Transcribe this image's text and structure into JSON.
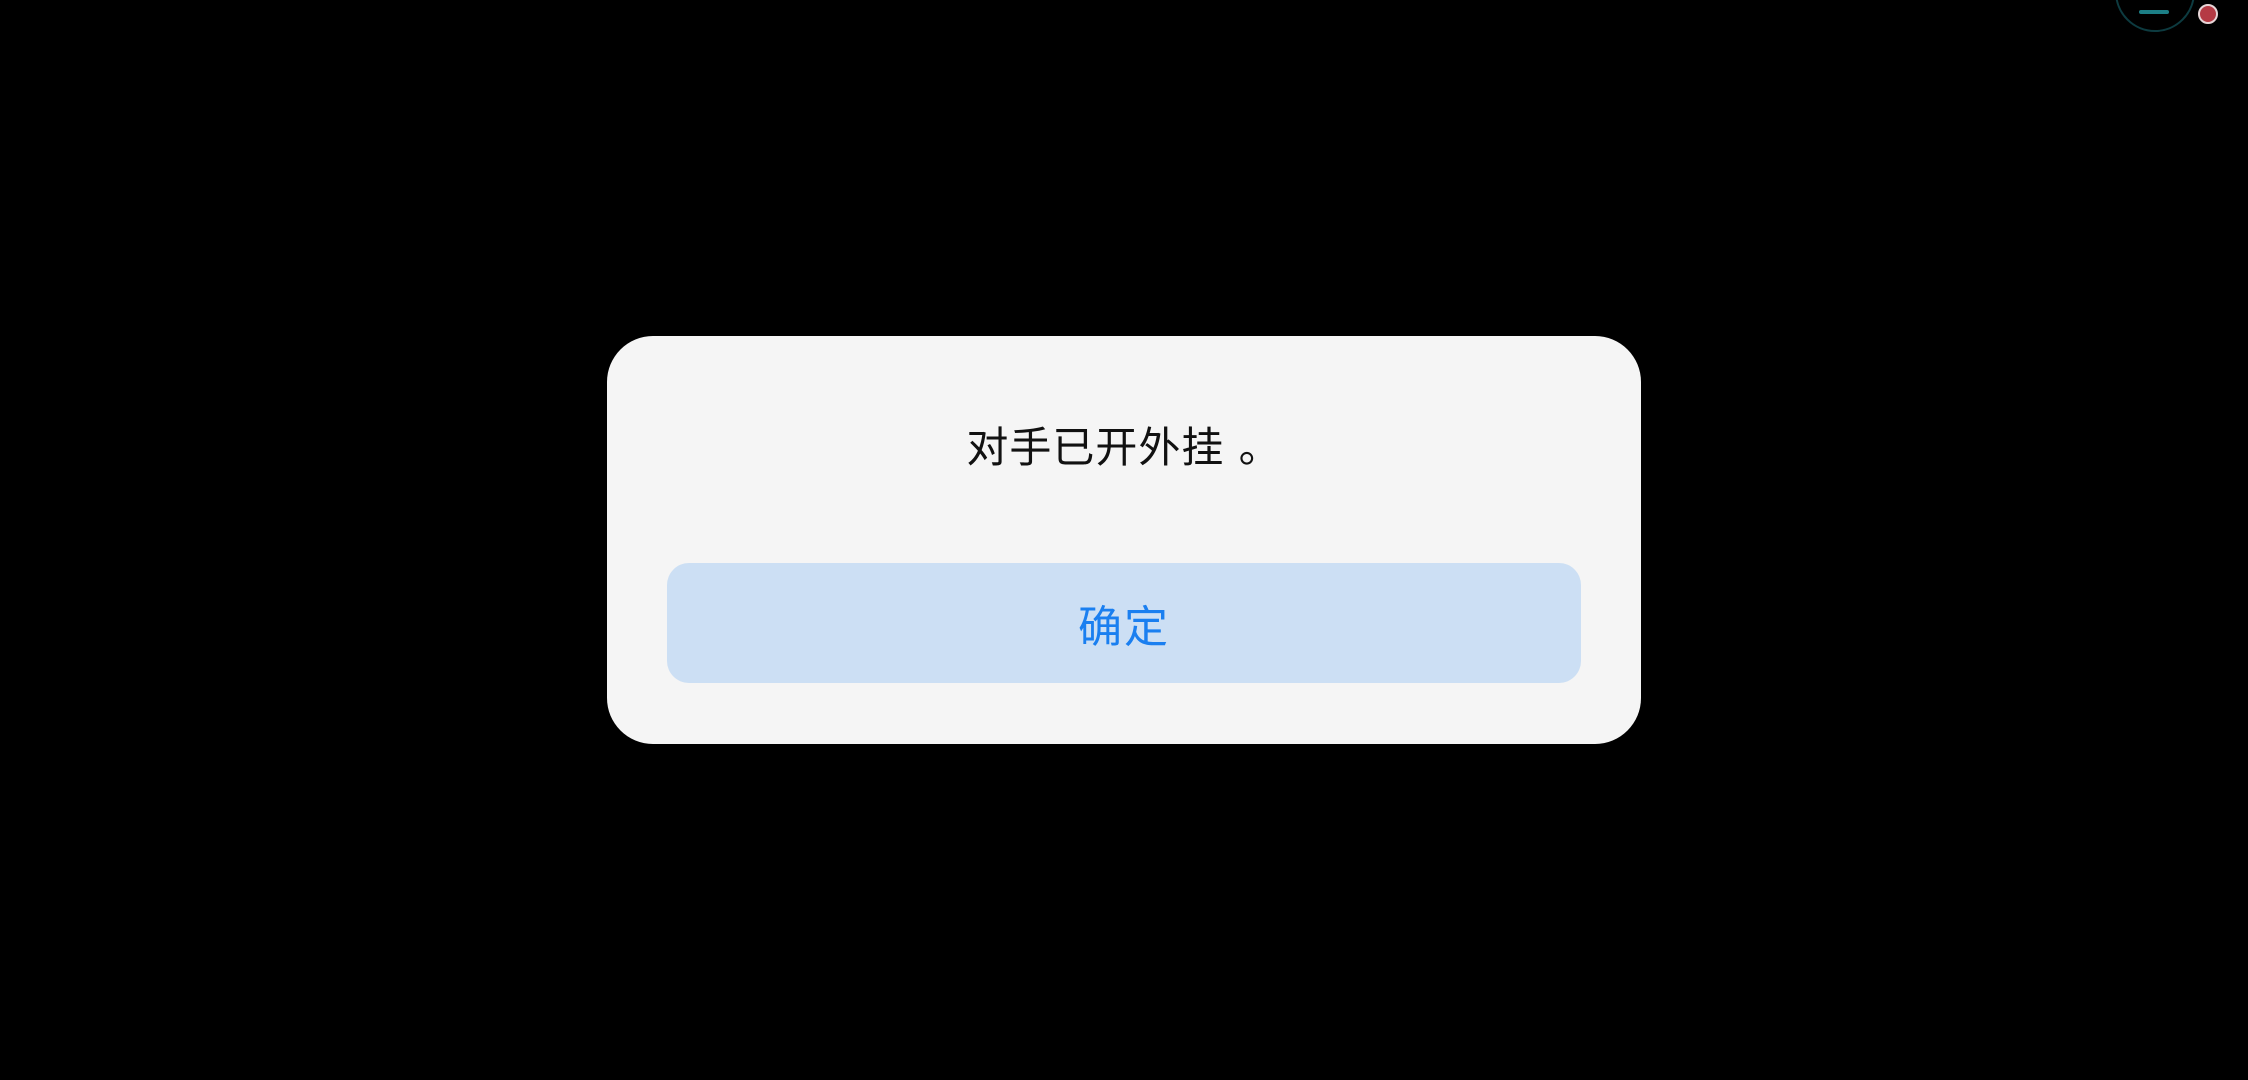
{
  "dialog": {
    "message": "对手已开外挂 。",
    "confirm_label": "确定"
  },
  "overlay": {
    "widget_icon": "floating-ball-icon",
    "record_indicator_icon": "recording-dot-icon"
  },
  "colors": {
    "background": "#000000",
    "dialog_background": "#f5f5f5",
    "button_background": "#ccdff4",
    "button_text": "#1a7ff0",
    "message_text": "#111111",
    "record_dot": "#b53a44"
  }
}
